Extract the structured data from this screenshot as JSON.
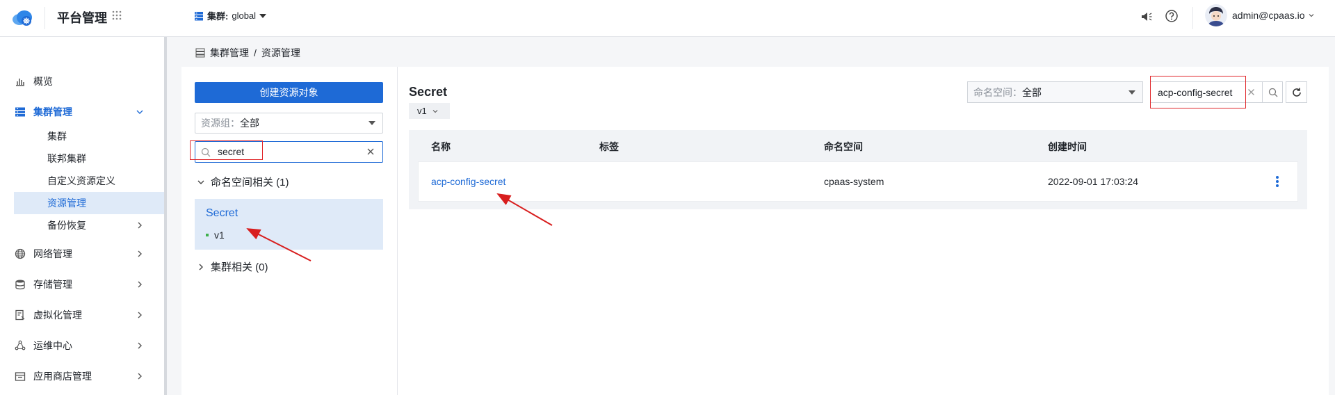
{
  "header": {
    "app_title": "平台管理",
    "cluster_label": "集群:",
    "cluster_value": "global",
    "user": "admin@cpaas.io"
  },
  "sidebar": {
    "items": [
      {
        "label": "概览",
        "icon": "bar-chart-icon"
      },
      {
        "label": "集群管理",
        "icon": "server-icon",
        "expanded": true
      },
      {
        "label": "网络管理",
        "icon": "globe-icon"
      },
      {
        "label": "存储管理",
        "icon": "database-icon"
      },
      {
        "label": "虚拟化管理",
        "icon": "virtualization-icon"
      },
      {
        "label": "运维中心",
        "icon": "ops-icon"
      },
      {
        "label": "应用商店管理",
        "icon": "store-icon"
      }
    ],
    "sub_items": [
      {
        "label": "集群"
      },
      {
        "label": "联邦集群"
      },
      {
        "label": "自定义资源定义"
      },
      {
        "label": "资源管理",
        "selected": true
      },
      {
        "label": "备份恢复"
      }
    ]
  },
  "breadcrumb": {
    "parent": "集群管理",
    "separator": "/",
    "current": "资源管理"
  },
  "left_panel": {
    "create_label": "创建资源对象",
    "group_select_label": "资源组：",
    "group_select_value": "全部",
    "search_value": "secret",
    "groups": [
      {
        "label": "命名空间相关 (1)",
        "expanded": true
      },
      {
        "label": "集群相关 (0)",
        "expanded": false
      }
    ],
    "selected_kind": "Secret",
    "selected_version": "v1"
  },
  "content": {
    "kind_title": "Secret",
    "version": "v1",
    "ns_select_label": "命名空间：",
    "ns_select_value": "全部",
    "name_search_value": "acp-config-secret",
    "columns": [
      "名称",
      "标签",
      "命名空间",
      "创建时间"
    ],
    "rows": [
      {
        "name": "acp-config-secret",
        "labels": "",
        "namespace": "cpaas-system",
        "created": "2022-09-01 17:03:24"
      }
    ]
  },
  "colors": {
    "primary": "#1e6ad6",
    "highlight_border": "#e0262a",
    "selected_bg": "#dfeaf8"
  }
}
